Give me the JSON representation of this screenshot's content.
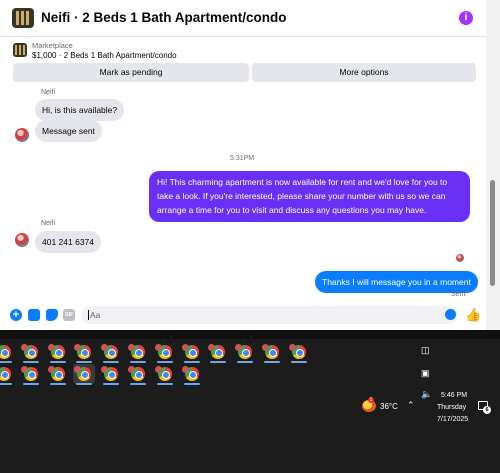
{
  "header": {
    "title": "Neifi · 2 Beds 1 Bath Apartment/condo"
  },
  "listing": {
    "marketplace_label": "Marketplace",
    "price_line": "$1,000 · 2 Beds 1 Bath Apartment/condo",
    "mark_pending_label": "Mark as pending",
    "more_options_label": "More options"
  },
  "messages": {
    "sender_name_1": "Neifi",
    "msg_1": "Hi, is this available?",
    "msg_2": "Message sent",
    "timestamp": "5:31PM",
    "outgoing_1": "Hi! This charming apartment is now available for rent and we'd love for you to take a look. If you're interested, please share your number with us so we can arrange a time for you to visit and discuss any questions you may have.",
    "sender_name_2": "Neifi",
    "msg_3": "401 241 6374",
    "outgoing_2": "Thanks I will message you in a moment",
    "status": "Sent"
  },
  "composer": {
    "placeholder": "Aa"
  },
  "taskbar": {
    "row1_count": 12,
    "row2_count": 8,
    "temperature": "36°C",
    "time": "5:46 PM",
    "day": "Thursday",
    "date": "7/17/2025",
    "notification_count": "6"
  },
  "colors": {
    "outgoing_purple": "#6a2ff5",
    "outgoing_blue": "#0a7cff",
    "incoming_gray": "#e4e6eb",
    "taskbar_bg": "#1c1c1c"
  },
  "icons": [
    "info-icon",
    "plus-icon",
    "photo-icon",
    "sticker-icon",
    "gif-icon",
    "emoji-icon",
    "like-icon",
    "chrome-icon",
    "weather-icon",
    "chevron-up-icon",
    "speaker-icon",
    "notification-icon"
  ]
}
